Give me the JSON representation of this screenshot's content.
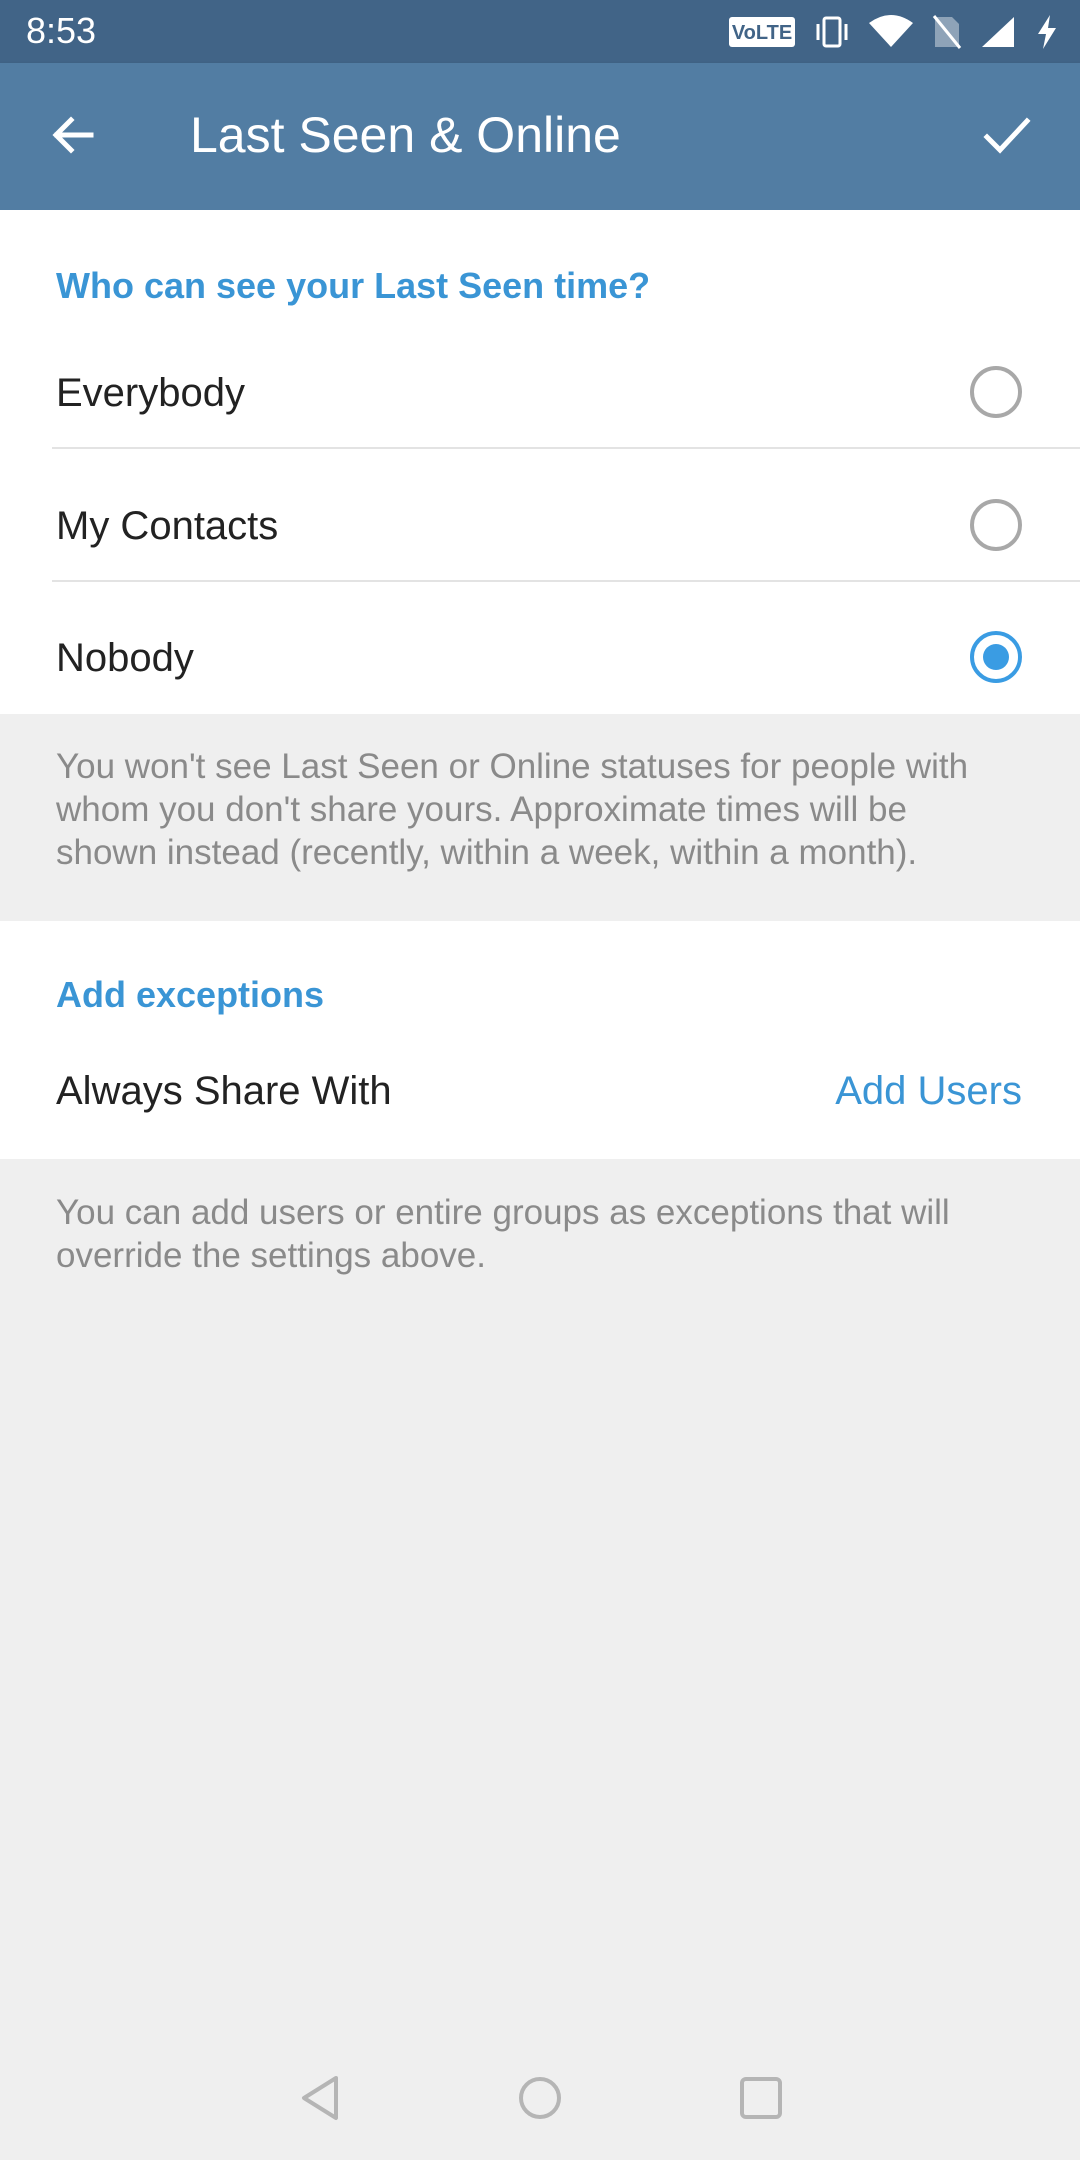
{
  "status_bar": {
    "time": "8:53",
    "volte_label": "VoLTE",
    "icons": [
      "volte-icon",
      "vibrate-icon",
      "wifi-icon",
      "no-sim-icon",
      "signal-icon",
      "charging-icon"
    ]
  },
  "app_bar": {
    "title": "Last Seen & Online",
    "back_icon": "arrow-left-icon",
    "done_icon": "check-icon"
  },
  "last_seen": {
    "header": "Who can see your Last Seen time?",
    "options": [
      {
        "label": "Everybody",
        "selected": false
      },
      {
        "label": "My Contacts",
        "selected": false
      },
      {
        "label": "Nobody",
        "selected": true
      }
    ],
    "info": "You won't see Last Seen or Online statuses for people with whom you don't share yours. Approximate times will be shown instead (recently, within a week, within a month)."
  },
  "exceptions": {
    "header": "Add exceptions",
    "always_share_label": "Always Share With",
    "add_users_label": "Add Users",
    "info": "You can add users or entire groups as exceptions that will override the settings above."
  },
  "nav_bar": {
    "icons": [
      "nav-back-icon",
      "nav-home-icon",
      "nav-recents-icon"
    ]
  },
  "colors": {
    "status_bar": "#416487",
    "app_bar": "#527da3",
    "accent": "#3a95d5",
    "radio_checked": "#3a9ce3",
    "background": "#efefef"
  }
}
